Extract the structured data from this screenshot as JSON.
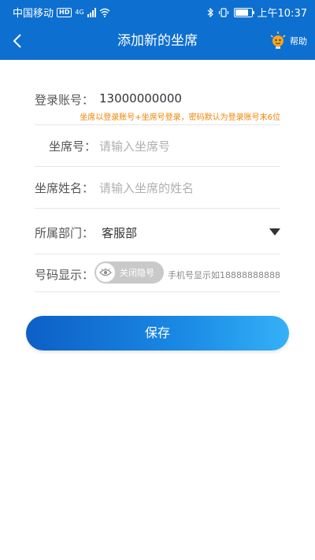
{
  "status_bar": {
    "carrier": "中国移动",
    "hd_badge": "HD",
    "network": "4G",
    "time": "上午10:37"
  },
  "nav": {
    "title": "添加新的坐席",
    "help_label": "帮助",
    "back_icon": "chevron-left-icon",
    "help_icon": "lightbulb-mascot-icon"
  },
  "form": {
    "account": {
      "label": "登录账号：",
      "value": "13000000000",
      "hint": "坐席以登录账号+坐席号登录，密码默认为登录账号末6位"
    },
    "seat_number": {
      "label": "坐席号：",
      "placeholder": "请输入坐席号"
    },
    "seat_name": {
      "label": "坐席姓名：",
      "placeholder": "请输入坐席的姓名"
    },
    "department": {
      "label": "所属部门：",
      "value": "客服部"
    },
    "number_display": {
      "label": "号码显示：",
      "toggle_label": "关闭隐号",
      "toggle_on": false,
      "hint": "手机号显示如18888888888"
    }
  },
  "save_button": "保存",
  "colors": {
    "primary": "#0d6fd0",
    "hint_orange": "#f08300",
    "toggle_off": "#c9c9c9"
  }
}
